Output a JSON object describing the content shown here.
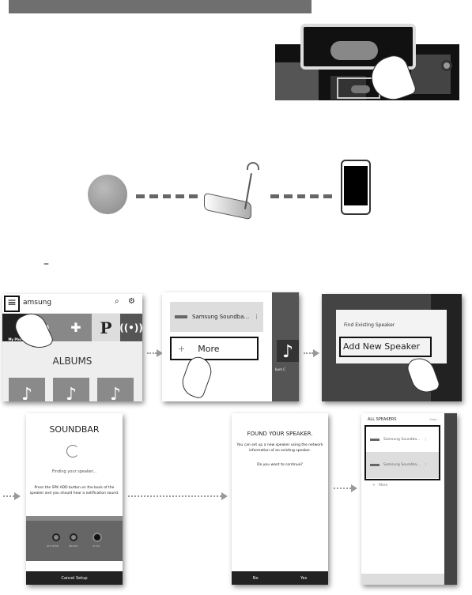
{
  "colors": {
    "header": "#6f6f6f",
    "dark": "#222222",
    "highlight": "#111111"
  },
  "remote_illustration": {
    "icon": "remote-button-press-illustration"
  },
  "network": {
    "icons": [
      "globe-icon",
      "wireless-router-icon",
      "smartphone-icon"
    ]
  },
  "step_marker": "–",
  "panel1": {
    "search_text": "amsung",
    "tiles": [
      "My Phone",
      "a",
      "P"
    ],
    "section": "ALBUMS"
  },
  "panel2": {
    "speaker": "Samsung Soundba...",
    "more_label": "More",
    "album_label": "bum C"
  },
  "panel3": {
    "find_existing": "Find Existing Speaker",
    "add_new": "Add New Speaker"
  },
  "panel4": {
    "title": "SOUNDBAR",
    "status": "Finding your speaker...",
    "instruction": "Press the SPK ADD button on the back of the speaker and you should hear a notification sound.",
    "ports": [
      "WI-FI SETUP",
      "SPK ADD",
      "DC 24V"
    ],
    "cancel": "Cancel Setup"
  },
  "panel5": {
    "title": "FOUND YOUR SPEAKER.",
    "body": "You can set up a new speaker using the network information of an existing speaker.",
    "question": "Do you want to continue?",
    "no": "No",
    "yes": "Yes"
  },
  "panel6": {
    "header": "ALL SPEAKERS",
    "close": "Close",
    "speakers": [
      "Samsung Soundba...",
      "Samsung Soundba..."
    ],
    "more": "More"
  }
}
